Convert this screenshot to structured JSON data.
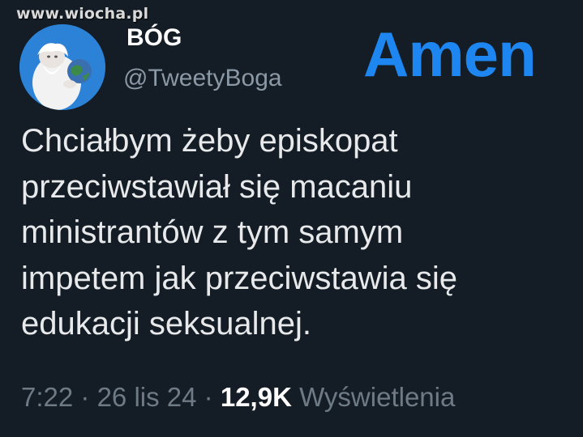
{
  "watermark": "www.wiocha.pl",
  "author": {
    "display_name": "BÓG",
    "handle": "@TweetyBoga"
  },
  "overlay_text": "Amen",
  "tweet": {
    "lines": [
      "Chciałbym żeby episkopat",
      "przeciwstawiał się macaniu",
      "ministrantów z tym samym",
      "impetem jak przeciwstawia się",
      "edukacji seksualnej."
    ]
  },
  "meta": {
    "time": "7:22",
    "separator": "·",
    "date": "26 lis 24",
    "views_count": "12,9K",
    "views_label": "Wyświetlenia"
  },
  "colors": {
    "background": "#141d26",
    "accent": "#1d86f0",
    "secondary_text": "#8b98a5"
  }
}
